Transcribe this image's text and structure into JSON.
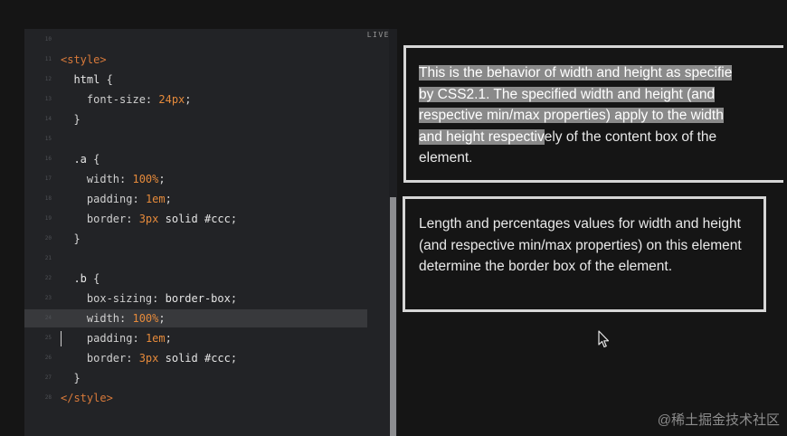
{
  "editor": {
    "live_label": "LIVE",
    "lines": [
      {
        "num": "10",
        "segments": []
      },
      {
        "num": "11",
        "segments": [
          {
            "c": "tag",
            "t": "<style>"
          }
        ]
      },
      {
        "num": "12",
        "segments": [
          {
            "c": "sel",
            "t": "  html "
          },
          {
            "c": "pun",
            "t": "{"
          }
        ]
      },
      {
        "num": "13",
        "segments": [
          {
            "c": "prop",
            "t": "    font-size"
          },
          {
            "c": "pun",
            "t": ": "
          },
          {
            "c": "num",
            "t": "24px"
          },
          {
            "c": "pun",
            "t": ";"
          }
        ]
      },
      {
        "num": "14",
        "segments": [
          {
            "c": "pun",
            "t": "  }"
          }
        ]
      },
      {
        "num": "15",
        "segments": []
      },
      {
        "num": "16",
        "segments": [
          {
            "c": "sel",
            "t": "  .a "
          },
          {
            "c": "pun",
            "t": "{"
          }
        ]
      },
      {
        "num": "17",
        "segments": [
          {
            "c": "prop",
            "t": "    width"
          },
          {
            "c": "pun",
            "t": ": "
          },
          {
            "c": "num",
            "t": "100%"
          },
          {
            "c": "pun",
            "t": ";"
          }
        ]
      },
      {
        "num": "18",
        "segments": [
          {
            "c": "prop",
            "t": "    padding"
          },
          {
            "c": "pun",
            "t": ": "
          },
          {
            "c": "num",
            "t": "1em"
          },
          {
            "c": "pun",
            "t": ";"
          }
        ]
      },
      {
        "num": "19",
        "segments": [
          {
            "c": "prop",
            "t": "    border"
          },
          {
            "c": "pun",
            "t": ": "
          },
          {
            "c": "num",
            "t": "3px"
          },
          {
            "c": "kw",
            "t": " solid #ccc"
          },
          {
            "c": "pun",
            "t": ";"
          }
        ]
      },
      {
        "num": "20",
        "segments": [
          {
            "c": "pun",
            "t": "  }"
          }
        ]
      },
      {
        "num": "21",
        "segments": []
      },
      {
        "num": "22",
        "segments": [
          {
            "c": "sel",
            "t": "  .b "
          },
          {
            "c": "pun",
            "t": "{"
          }
        ]
      },
      {
        "num": "23",
        "segments": [
          {
            "c": "prop",
            "t": "    box-sizing"
          },
          {
            "c": "pun",
            "t": ": "
          },
          {
            "c": "kw",
            "t": "border-box"
          },
          {
            "c": "pun",
            "t": ";"
          }
        ]
      },
      {
        "num": "24",
        "highlight": true,
        "segments": [
          {
            "c": "prop",
            "t": "    width"
          },
          {
            "c": "pun",
            "t": ": "
          },
          {
            "c": "num",
            "t": "100%"
          },
          {
            "c": "pun",
            "t": ";"
          }
        ]
      },
      {
        "num": "25",
        "cursor": true,
        "segments": [
          {
            "c": "prop",
            "t": "    padding"
          },
          {
            "c": "pun",
            "t": ": "
          },
          {
            "c": "num",
            "t": "1em"
          },
          {
            "c": "pun",
            "t": ";"
          }
        ]
      },
      {
        "num": "26",
        "segments": [
          {
            "c": "prop",
            "t": "    border"
          },
          {
            "c": "pun",
            "t": ": "
          },
          {
            "c": "num",
            "t": "3px"
          },
          {
            "c": "kw",
            "t": " solid #ccc"
          },
          {
            "c": "pun",
            "t": ";"
          }
        ]
      },
      {
        "num": "27",
        "segments": [
          {
            "c": "pun",
            "t": "  }"
          }
        ]
      },
      {
        "num": "28",
        "segments": [
          {
            "c": "tag",
            "t": "</style>"
          }
        ]
      }
    ]
  },
  "preview": {
    "box_a": {
      "lines": [
        {
          "selected": "This is the behavior of width and height as specifie",
          "rest": ""
        },
        {
          "selected": "by CSS2.1. The specified width and height (and",
          "rest": ""
        },
        {
          "selected": "respective min/max properties) apply to the width",
          "rest": ""
        },
        {
          "selected": "and height respectiv",
          "rest": "ely of the content box of the"
        },
        {
          "selected": "",
          "rest": "element."
        }
      ]
    },
    "box_b": {
      "text": "Length and percentages values for width and height (and respective min/max properties) on this element determine the border box of the element."
    }
  },
  "watermark": "@稀土掘金技术社区",
  "colors": {
    "tag": "#d97a3a",
    "number": "#e58a3b",
    "editor_bg": "#222326",
    "page_bg": "#151515",
    "selection": "#8a8a8a"
  }
}
